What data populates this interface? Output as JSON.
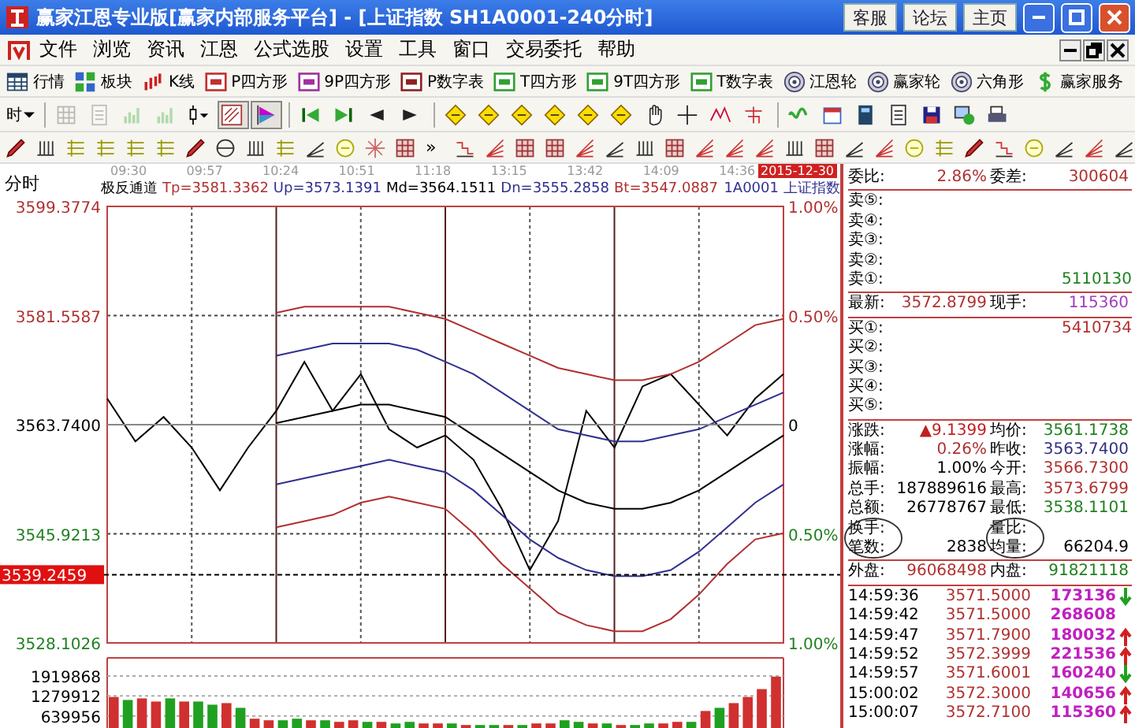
{
  "window": {
    "title": "赢家江恩专业版[赢家内部服务平台] - [上证指数  SH1A0001-240分时]",
    "links": [
      "客服",
      "论坛",
      "主页"
    ]
  },
  "menu": {
    "items": [
      "文件",
      "浏览",
      "资讯",
      "江恩",
      "公式选股",
      "设置",
      "工具",
      "窗口",
      "交易委托",
      "帮助"
    ]
  },
  "toolbar": {
    "items": [
      {
        "label": "行情",
        "kind": "table"
      },
      {
        "label": "板块",
        "kind": "tiles"
      },
      {
        "label": "K线",
        "kind": "candles"
      },
      {
        "label": "P四方形",
        "kind": "badge",
        "color": "#c03030"
      },
      {
        "label": "9P四方形",
        "kind": "badge",
        "color": "#a030a0"
      },
      {
        "label": "P数字表",
        "kind": "badge",
        "color": "#902020"
      },
      {
        "label": "T四方形",
        "kind": "badge",
        "color": "#30a030"
      },
      {
        "label": "9T四方形",
        "kind": "badge",
        "color": "#30a030"
      },
      {
        "label": "T数字表",
        "kind": "badge",
        "color": "#30a030"
      },
      {
        "label": "江恩轮",
        "kind": "wheel"
      },
      {
        "label": "赢家轮",
        "kind": "wheel"
      },
      {
        "label": "六角形",
        "kind": "wheel"
      },
      {
        "label": "赢家服务",
        "kind": "dollar"
      }
    ]
  },
  "chart_toolbar": {
    "period": "时",
    "tools": [
      {
        "kind": "grid",
        "disabled": true,
        "pressed": false
      },
      {
        "kind": "page",
        "disabled": true,
        "pressed": false
      },
      {
        "kind": "bars",
        "disabled": true,
        "pressed": false
      },
      {
        "kind": "bars",
        "disabled": true,
        "pressed": false
      },
      {
        "kind": "candle-menu",
        "disabled": false,
        "pressed": false
      },
      {
        "kind": "weight",
        "disabled": false,
        "pressed": true
      },
      {
        "kind": "flag",
        "disabled": false,
        "pressed": true
      },
      {
        "kind": "first",
        "disabled": false,
        "pressed": false
      },
      {
        "kind": "last",
        "disabled": false,
        "pressed": false
      },
      {
        "kind": "prev",
        "disabled": false,
        "pressed": false
      },
      {
        "kind": "next",
        "disabled": false,
        "pressed": false
      },
      {
        "kind": "diamond",
        "disabled": false,
        "pressed": false
      },
      {
        "kind": "diamond",
        "disabled": false,
        "pressed": false
      },
      {
        "kind": "diamond",
        "disabled": false,
        "pressed": false
      },
      {
        "kind": "diamond",
        "disabled": false,
        "pressed": false
      },
      {
        "kind": "diamond",
        "disabled": false,
        "pressed": false
      },
      {
        "kind": "diamond",
        "disabled": false,
        "pressed": false
      },
      {
        "kind": "hand",
        "disabled": false,
        "pressed": false
      },
      {
        "kind": "cross",
        "disabled": false,
        "pressed": false
      },
      {
        "kind": "zigzag",
        "disabled": false,
        "pressed": false
      },
      {
        "kind": "node",
        "disabled": false,
        "pressed": false
      },
      {
        "kind": "wave",
        "disabled": false,
        "pressed": false
      },
      {
        "kind": "calendar",
        "disabled": false,
        "pressed": false
      },
      {
        "kind": "calculator",
        "disabled": false,
        "pressed": false
      },
      {
        "kind": "notebook",
        "disabled": false,
        "pressed": false
      },
      {
        "kind": "save",
        "disabled": false,
        "pressed": false
      },
      {
        "kind": "monitor",
        "disabled": false,
        "pressed": false
      },
      {
        "kind": "printer",
        "disabled": false,
        "pressed": false
      }
    ]
  },
  "drawing_toolbar": {
    "more": "»"
  },
  "chart": {
    "view": "分时",
    "time_labels": [
      "09:30",
      "09:57",
      "10:24",
      "10:51",
      "11:18",
      "13:15",
      "13:42",
      "14:09",
      "14:36"
    ],
    "date": "2015-12-30",
    "cursor_price": "3539.2459",
    "indicator": {
      "name": "极反通道",
      "values": [
        {
          "text": "Tp=3581.3362",
          "color": "#b03030"
        },
        {
          "text": "Up=3573.1391",
          "color": "#303090"
        },
        {
          "text": "Md=3564.1511",
          "color": "#000000"
        },
        {
          "text": "Dn=3555.2858",
          "color": "#303090"
        },
        {
          "text": "Bt=3547.0887",
          "color": "#b03030"
        }
      ]
    },
    "symbol": "1A0001",
    "symbol_name": "上证指数",
    "ytick_label_styles": [
      {
        "color": "#b03030"
      },
      {
        "color": "#b03030"
      },
      {
        "color": "#000000"
      },
      {
        "color": "#208020"
      },
      {
        "color": "#208020"
      }
    ],
    "right_labels": [
      {
        "text": "1.00%",
        "color": "#b03030"
      },
      {
        "text": "0.50%",
        "color": "#b03030"
      },
      {
        "text": "0",
        "color": "#000000"
      },
      {
        "text": "0.50%",
        "color": "#208020"
      },
      {
        "text": "1.00%",
        "color": "#208020"
      }
    ],
    "chart_data": {
      "type": "line",
      "grid": true,
      "ylim": [
        3528.1026,
        3599.3774
      ],
      "categories": [
        null,
        null,
        null,
        null,
        null,
        null,
        null,
        null,
        null,
        null,
        null,
        null,
        null,
        null,
        null,
        null,
        null,
        null,
        null,
        null,
        null,
        null,
        null,
        null,
        null
      ],
      "yticks": [
        {
          "value": 3599.3774,
          "label": "3599.3774"
        },
        {
          "value": 3581.5587,
          "label": "3581.5587"
        },
        {
          "value": 3563.74,
          "label": "3563.7400"
        },
        {
          "value": 3545.9213,
          "label": "3545.9213"
        },
        {
          "value": 3528.1026,
          "label": "3528.1026"
        }
      ],
      "series": [
        {
          "color": "#000000",
          "values": [
            3568,
            3561,
            3565,
            3560,
            3553,
            3560,
            3566,
            3574,
            3566,
            3572,
            3563,
            3560,
            3562,
            3558,
            3550,
            3540,
            3548,
            3566,
            3560,
            3570,
            3572,
            3567,
            3562,
            3568,
            3572
          ]
        },
        {
          "color": "#b03030",
          "values": [
            null,
            null,
            null,
            null,
            null,
            null,
            3582,
            3583,
            3583,
            3583,
            3583,
            3582,
            3581,
            3579,
            3577,
            3575,
            3573,
            3572,
            3571,
            3571,
            3572,
            3574,
            3577,
            3580,
            3581
          ]
        },
        {
          "color": "#303090",
          "values": [
            null,
            null,
            null,
            null,
            null,
            null,
            3575,
            3576,
            3577,
            3577,
            3577,
            3576,
            3574,
            3572,
            3569,
            3566,
            3563,
            3562,
            3561,
            3561,
            3562,
            3563,
            3565,
            3567,
            3569
          ]
        },
        {
          "color": "#000000",
          "values": [
            null,
            null,
            null,
            null,
            null,
            null,
            3564,
            3565,
            3566,
            3567,
            3567,
            3566,
            3565,
            3562,
            3559,
            3556,
            3553,
            3551,
            3550,
            3550,
            3551,
            3553,
            3556,
            3559,
            3562
          ]
        },
        {
          "color": "#303090",
          "values": [
            null,
            null,
            null,
            null,
            null,
            null,
            3554,
            3555,
            3556,
            3557,
            3558,
            3557,
            3556,
            3553,
            3549,
            3545,
            3542,
            3540,
            3539,
            3539,
            3540,
            3543,
            3547,
            3551,
            3554
          ]
        },
        {
          "color": "#b03030",
          "values": [
            null,
            null,
            null,
            null,
            null,
            null,
            3547,
            3548,
            3549,
            3551,
            3552,
            3551,
            3550,
            3546,
            3541,
            3537,
            3533,
            3531,
            3530,
            3530,
            3532,
            3536,
            3541,
            3545,
            3546
          ]
        }
      ]
    }
  },
  "volume": {
    "chart_data": {
      "type": "bar",
      "grid": true,
      "stacked": true,
      "ylim": [
        0,
        2500000
      ],
      "categories": [
        null,
        null,
        null,
        null,
        null,
        null,
        null,
        null,
        null,
        null,
        null,
        null,
        null,
        null,
        null,
        null,
        null,
        null,
        null,
        null,
        null,
        null,
        null,
        null,
        null,
        null,
        null,
        null,
        null,
        null,
        null,
        null,
        null,
        null,
        null,
        null,
        null,
        null,
        null,
        null,
        null,
        null,
        null,
        null,
        null,
        null,
        null,
        null
      ],
      "yticks": [
        {
          "value": 1919868,
          "label": "1919868"
        },
        {
          "value": 1279912,
          "label": "1279912"
        },
        {
          "value": 639956,
          "label": "639956"
        }
      ],
      "series": [
        {
          "color": "#d03030",
          "values": [
            1250000,
            null,
            1200000,
            1100000,
            null,
            1100000,
            null,
            null,
            1050000,
            null,
            550000,
            500000,
            null,
            null,
            500000,
            null,
            450000,
            500000,
            null,
            450000,
            null,
            null,
            400000,
            400000,
            null,
            350000,
            null,
            null,
            350000,
            null,
            400000,
            400000,
            null,
            null,
            400000,
            null,
            350000,
            null,
            null,
            400000,
            450000,
            null,
            800000,
            null,
            1050000,
            1250000,
            1500000,
            1900000
          ]
        },
        {
          "color": "#20a020",
          "values": [
            null,
            1150000,
            null,
            null,
            1200000,
            null,
            1100000,
            1000000,
            null,
            900000,
            null,
            null,
            500000,
            550000,
            null,
            500000,
            null,
            null,
            450000,
            null,
            400000,
            450000,
            null,
            null,
            400000,
            null,
            350000,
            350000,
            null,
            350000,
            null,
            null,
            500000,
            450000,
            null,
            400000,
            null,
            350000,
            400000,
            null,
            null,
            450000,
            null,
            900000,
            null,
            null,
            null,
            null
          ]
        }
      ]
    }
  },
  "quote": {
    "ratio": [
      {
        "label": "委比:",
        "value": "2.86%",
        "color": "#b03030"
      },
      {
        "label": "委差:",
        "value": "300604",
        "color": "#b03030"
      }
    ],
    "asks": [
      {
        "label": "卖⑤:"
      },
      {
        "label": "卖④:"
      },
      {
        "label": "卖③:"
      },
      {
        "label": "卖②:"
      },
      {
        "label": "卖①:",
        "volume": "5110130",
        "color": "#208020"
      }
    ],
    "last": [
      {
        "label": "最新:",
        "value": "3572.8799",
        "color": "#b03030"
      },
      {
        "label": "现手:",
        "value": "115360",
        "color": "#a040c0"
      }
    ],
    "bids": [
      {
        "label": "买①:",
        "volume": "5410734",
        "color": "#b03030"
      },
      {
        "label": "买②:"
      },
      {
        "label": "买③:"
      },
      {
        "label": "买④:"
      },
      {
        "label": "买⑤:"
      }
    ],
    "stats": [
      {
        "label": "涨跌:",
        "value": "▲9.1399",
        "color": "#c02020",
        "circled": false
      },
      {
        "label": "均价:",
        "value": "3561.1738",
        "color": "#208020",
        "circled": false
      },
      {
        "label": "涨幅:",
        "value": "0.26%",
        "color": "#b03030",
        "circled": false
      },
      {
        "label": "昨收:",
        "value": "3563.7400",
        "color": "#303080",
        "circled": false
      },
      {
        "label": "振幅:",
        "value": "1.00%",
        "color": "#000000",
        "circled": false
      },
      {
        "label": "今开:",
        "value": "3566.7300",
        "color": "#b03030",
        "circled": false
      },
      {
        "label": "总手:",
        "value": "187889616",
        "color": "#000000",
        "circled": false
      },
      {
        "label": "最高:",
        "value": "3573.6799",
        "color": "#b03030",
        "circled": false
      },
      {
        "label": "总额:",
        "value": "26778767",
        "color": "#000000",
        "circled": false
      },
      {
        "label": "最低:",
        "value": "3538.1101",
        "color": "#208020",
        "circled": false
      },
      {
        "label": "换手:",
        "circled": true
      },
      {
        "label": "量比:",
        "circled": true
      },
      {
        "label": "笔数:",
        "value": "2838",
        "color": "#000000",
        "circled": false
      },
      {
        "label": "均量:",
        "value": "66204.9",
        "color": "#000000",
        "circled": false
      }
    ],
    "flow": [
      {
        "label": "外盘:",
        "value": "96068498",
        "color": "#b03030"
      },
      {
        "label": "内盘:",
        "value": "91821118",
        "color": "#208020"
      }
    ],
    "trades": [
      {
        "time": "14:59:36",
        "price": "3571.5000",
        "volume": "173136",
        "kind": "down"
      },
      {
        "time": "14:59:42",
        "price": "3571.5000",
        "volume": "268608",
        "kind": "none"
      },
      {
        "time": "14:59:47",
        "price": "3571.7900",
        "volume": "180032",
        "kind": "up"
      },
      {
        "time": "14:59:52",
        "price": "3572.3999",
        "volume": "221536",
        "kind": "up"
      },
      {
        "time": "14:59:57",
        "price": "3571.6001",
        "volume": "160240",
        "kind": "down"
      },
      {
        "time": "15:00:02",
        "price": "3572.3000",
        "volume": "140656",
        "kind": "up"
      },
      {
        "time": "15:00:07",
        "price": "3572.7100",
        "volume": "115360",
        "kind": "up"
      }
    ]
  }
}
